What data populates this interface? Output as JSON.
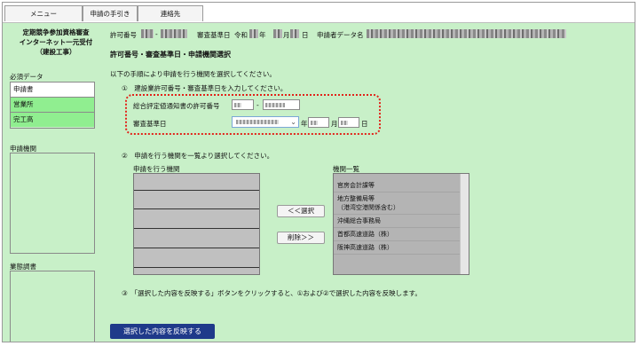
{
  "tabs": [
    "メニュー",
    "申請の手引き",
    "連絡先"
  ],
  "header": {
    "line1": "定期競争参加資格審査",
    "line2": "インターネット一元受付",
    "line3": "（建設工事）",
    "permit_label": "許可番号",
    "permit_dash": "-",
    "review_label": "審査基準日",
    "era": "令和",
    "year_unit": "年",
    "month_unit": "月",
    "day_unit": "日",
    "applicant_label": "申請者データ名"
  },
  "sidebar": {
    "required_title": "必須データ",
    "required_items": [
      {
        "label": "申請書",
        "state": "white"
      },
      {
        "label": "営業所",
        "state": "green"
      },
      {
        "label": "完工高",
        "state": "green"
      }
    ],
    "agency_title": "申請機関",
    "report_title": "業態調書"
  },
  "main": {
    "section_title": "許可番号・審査基準日・申請機関選択",
    "instruction": "以下の手順により申請を行う機関を選択してください。",
    "step1": "①　建設業許可番号・審査基準日を入力してください。",
    "permit_field_label": "総合評定値通知書の許可番号",
    "permit_dash": "-",
    "review_field_label": "審査基準日",
    "year_unit": "年",
    "month_unit": "月",
    "day_unit": "日",
    "step2": "②　申請を行う機関を一覧より選択してください。",
    "selected_title": "申請を行う機関",
    "list_title": "機関一覧",
    "select_button": "＜＜選択",
    "delete_button": "削除＞＞",
    "agencies": [
      "官房会計課等",
      "地方整備局等\n（港湾空港関係含む）",
      "沖縄総合事務局",
      "首都高速道路（株）",
      "阪神高速道路（株）"
    ],
    "step3": "③　「選択した内容を反映する」ボタンをクリックすると、①および②で選択した内容を反映します。",
    "submit_button": "選択した内容を反映する"
  },
  "colors": {
    "background": "#c8f0c8",
    "highlight": "#90ee90",
    "callout": "#e2231a",
    "submit": "#1f3a8a"
  }
}
